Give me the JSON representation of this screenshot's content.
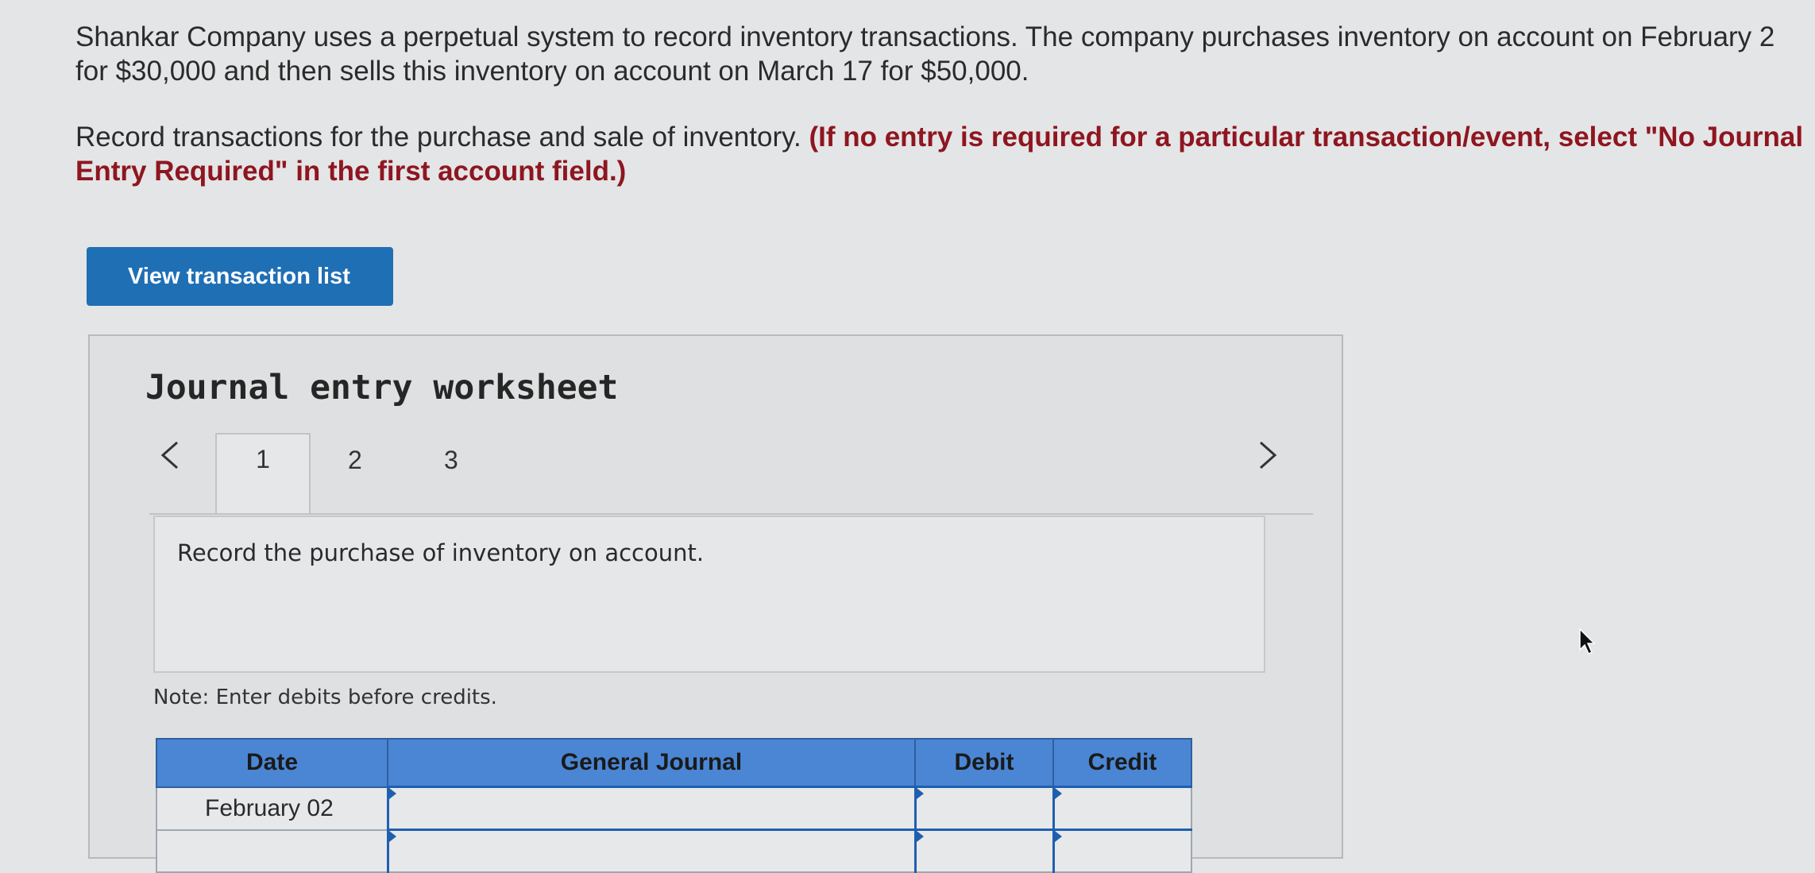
{
  "intro": {
    "paragraph1": "Shankar Company uses a perpetual system to record inventory transactions. The company purchases inventory on account on February 2 for $30,000 and then sells this inventory on account on March 17 for $50,000.",
    "paragraph2_plain": "Record transactions for the purchase and sale of inventory. ",
    "paragraph2_emphasis": "(If no entry is required for a particular transaction/event, select \"No Journal Entry Required\" in the first account field.)"
  },
  "buttons": {
    "view_transaction_list": "View transaction list"
  },
  "worksheet": {
    "title": "Journal entry worksheet",
    "tabs": [
      {
        "label": "1",
        "active": true
      },
      {
        "label": "2",
        "active": false
      },
      {
        "label": "3",
        "active": false
      }
    ],
    "instruction": "Record the purchase of inventory on account.",
    "note": "Note: Enter debits before credits.",
    "table": {
      "headers": [
        "Date",
        "General Journal",
        "Debit",
        "Credit"
      ],
      "rows": [
        {
          "date": "February 02",
          "account": "",
          "debit": "",
          "credit": ""
        },
        {
          "date": "",
          "account": "",
          "debit": "",
          "credit": ""
        }
      ]
    }
  },
  "icons": {
    "prev": "chevron-left-icon",
    "next": "chevron-right-icon",
    "cursor": "mouse-pointer-icon"
  },
  "colors": {
    "button_blue": "#1f6fb5",
    "emphasis_red": "#8e1620",
    "table_header_blue": "#4a86d4"
  }
}
